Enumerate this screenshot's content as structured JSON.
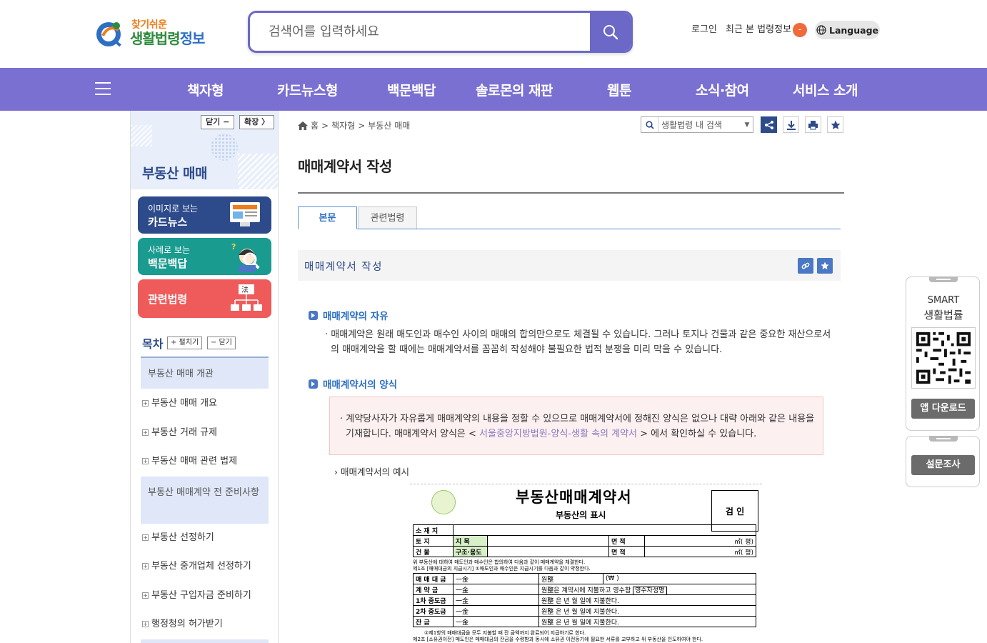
{
  "header": {
    "logo_small": "찾기쉬운",
    "logo_main": "생활법령",
    "logo_suffix": "정보",
    "search_placeholder": "검색어를 입력하세요",
    "login": "로그인",
    "recent": "최근 본 법령정보",
    "recent_badge": "-",
    "language": "Language"
  },
  "nav": {
    "items": [
      "책자형",
      "카드뉴스형",
      "백문백답",
      "솔로몬의 재판",
      "웹툰",
      "소식·참여",
      "서비스 소개"
    ]
  },
  "sidebar": {
    "close_btn": "닫기 −",
    "expand_btn": "확장 〉",
    "title": "부동산 매매",
    "cards": [
      {
        "sub": "이미지로 보는",
        "main": "카드뉴스",
        "color": "#2d4a8a"
      },
      {
        "sub": "사례로 보는",
        "main": "백문백답",
        "color": "#1a9b8f"
      },
      {
        "sub": "",
        "main": "관련법령",
        "color": "#ef5a5a"
      }
    ],
    "toc_title": "목차",
    "toc_expand": "+ 펼치기",
    "toc_close": "− 닫기",
    "toc_items": [
      {
        "label": "부동산 매매 개관",
        "type": "section"
      },
      {
        "label": "부동산 매매 개요",
        "type": "item"
      },
      {
        "label": "부동산 거래 규제",
        "type": "item"
      },
      {
        "label": "부동산 매매 관련 법제",
        "type": "item"
      },
      {
        "label": "부동산 매매계약 전 준비사항",
        "type": "section"
      },
      {
        "label": "부동산 선정하기",
        "type": "item"
      },
      {
        "label": "부동산 중개업체 선정하기",
        "type": "item"
      },
      {
        "label": "부동산 구입자금 준비하기",
        "type": "item"
      },
      {
        "label": "행정청의 허가받기",
        "type": "item"
      }
    ]
  },
  "main": {
    "breadcrumb": [
      "홈",
      "책자형",
      "부동산 매매"
    ],
    "inner_search_placeholder": "생활법령 내 검색",
    "page_title": "매매계약서 작성",
    "tabs": [
      "본문",
      "관련법령"
    ],
    "section_title": "매매계약서 작성",
    "h_freedom": "매매계약의 자유",
    "para_freedom": "매매계약은 원래 매도인과 매수인 사이의 매매의 합의만으로도 체결될 수 있습니다. 그러나 토지나 건물과 같은 중요한 재산으로서의 매매계약을 할 때에는 매매계약서를 꼼꼼히 작성해야 불필요한 법적 분쟁을 미리 막을 수 있습니다.",
    "h_form": "매매계약서의 양식",
    "note_before": "계약당사자가 자유롭게 매매계약의 내용을 정할 수 있으므로 매매계약서에 정해진 양식은 없으나 대략 아래와 같은 내용을 기재합니다. 매매계약서 양식은 < ",
    "note_link": "서울중앙지방법원-양식-생활 속의 계약서",
    "note_after": " > 에서 확인하실 수 있습니다.",
    "example_label": "매매계약서의 예시"
  },
  "doc_image": {
    "title": "부동산매매계약서",
    "subtitle": "부동산의 표시",
    "stamp": "검 인",
    "rows1": [
      [
        "소 재 지",
        "",
        "",
        "",
        ""
      ],
      [
        "토    지",
        "지 목",
        "",
        "면    적",
        "㎡(          평)"
      ],
      [
        "건    물",
        "구조·용도",
        "",
        "면    적",
        "㎡(          평)"
      ]
    ],
    "rows2": [
      [
        "매 매 대 금",
        "一金",
        "원整",
        "(₩                                  )"
      ],
      [
        "계  약  금",
        "一金",
        "원整은 계약시에 지불하고 영수함",
        "영수자성명"
      ],
      [
        "1차 중도금",
        "一金",
        "원整 은          년          월          일에 지불한다."
      ],
      [
        "2차 중도금",
        "一金",
        "원整 은          년          월          일에 지불한다."
      ],
      [
        "잔      금",
        "一金",
        "원整 은          년          월          일에 지불한다."
      ]
    ],
    "note1": "위 부동산에 대하여 매도인과 매수인은 합의하여 다음과 같이 매매계약을 체결한다.",
    "note2": "제1조 [매매대금의 지급시기] ①매도인과 매수인은 지급시기를 다음과 같이 약정한다.",
    "note3": "②제1항의 매매대금을 모두 지불할 때 잔 금액까지 완료되어 지급하기로 한다.",
    "note4": "제2조 [소유권이전] 매도인은 매매대금의 잔금을 수령함과 동시에 소유권 이전등기에 필요한 서류를 교부하고 위 부동산을 인도하여야 한다."
  },
  "right_panel": {
    "smart_label1": "SMART",
    "smart_label2": "생활법률",
    "app_download": "앱 다운로드",
    "survey": "설문조사"
  },
  "colors": {
    "nav_bg": "#7a70d2",
    "search_border": "#6c68c7",
    "accent_blue": "#2d4a8a",
    "link_blue": "#2d6fc4"
  }
}
